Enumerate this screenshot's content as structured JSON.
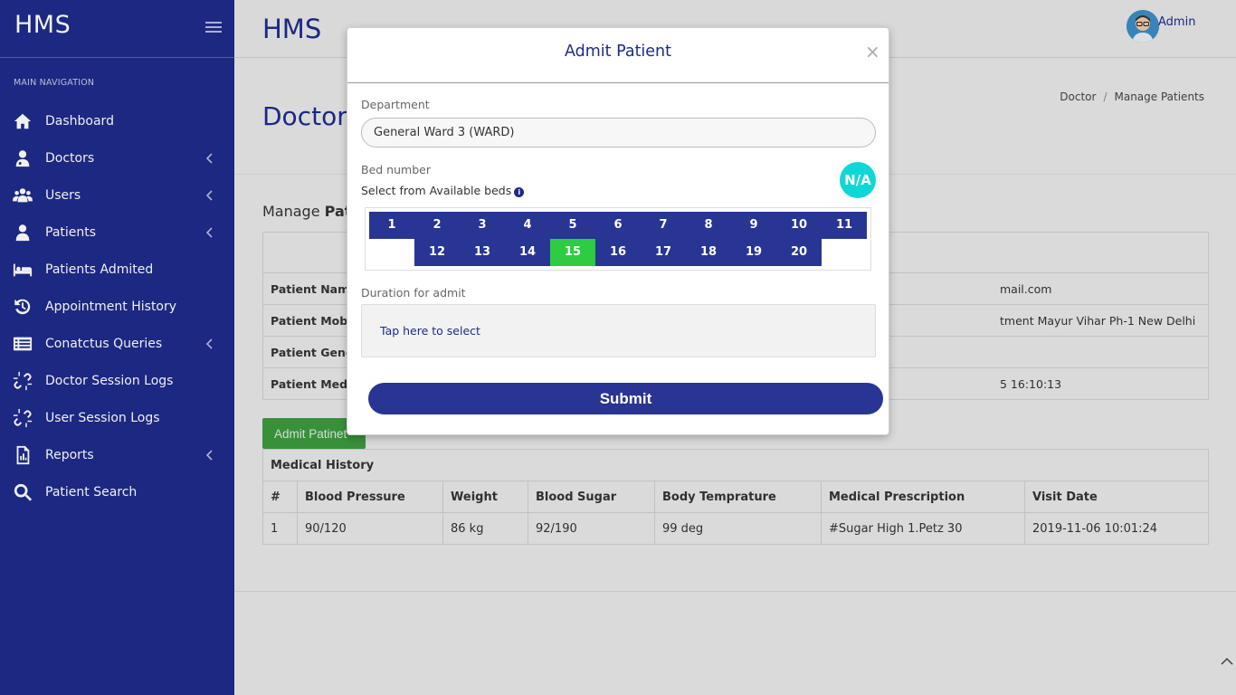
{
  "sidebar": {
    "brand": "HMS",
    "nav_header": "MAIN NAVIGATION",
    "items": [
      {
        "label": "Dashboard",
        "icon": "home-icon",
        "has_submenu": false
      },
      {
        "label": "Doctors",
        "icon": "doctor-icon",
        "has_submenu": true
      },
      {
        "label": "Users",
        "icon": "users-icon",
        "has_submenu": true
      },
      {
        "label": "Patients",
        "icon": "user-icon",
        "has_submenu": true
      },
      {
        "label": "Patients Admited",
        "icon": "bed-icon",
        "has_submenu": false
      },
      {
        "label": "Appointment History",
        "icon": "history-icon",
        "has_submenu": false
      },
      {
        "label": "Conatctus Queries",
        "icon": "list-icon",
        "has_submenu": true
      },
      {
        "label": "Doctor Session Logs",
        "icon": "unlink-icon",
        "has_submenu": false
      },
      {
        "label": "User Session Logs",
        "icon": "unlink-icon",
        "has_submenu": false
      },
      {
        "label": "Reports",
        "icon": "report-icon",
        "has_submenu": true
      },
      {
        "label": "Patient Search",
        "icon": "search-icon",
        "has_submenu": false
      }
    ]
  },
  "topbar": {
    "title": "HMS",
    "user": "Admin"
  },
  "page": {
    "title": "Doctor",
    "breadcrumb": [
      "Doctor",
      "Manage Patients"
    ],
    "heading_prefix": "Manage",
    "heading_bold": "Pati"
  },
  "patient_info": {
    "rows": [
      {
        "key": "Patient Name",
        "value": "mail.com"
      },
      {
        "key": "Patient Mobile",
        "value": "tment Mayur Vihar Ph-1 New Delhi"
      },
      {
        "key": "Patient Gende",
        "value": ""
      },
      {
        "key": "Patient Medic",
        "value": "5 16:10:13"
      }
    ]
  },
  "admit_button": "Admit Patinet",
  "medical_history": {
    "caption": "Medical History",
    "headers": [
      "#",
      "Blood Pressure",
      "Weight",
      "Blood Sugar",
      "Body Temprature",
      "Medical Prescription",
      "Visit Date"
    ],
    "rows": [
      [
        "1",
        "90/120",
        "86 kg",
        "92/190",
        "99 deg",
        "#Sugar High 1.Petz 30",
        "2019-11-06 10:01:24"
      ]
    ]
  },
  "modal": {
    "title": "Admit Patient",
    "close": "×",
    "department_label": "Department",
    "department_value": "General Ward 3 (WARD)",
    "bed_label": "Bed number",
    "bed_sub": "Select from Available beds",
    "badge": "N/A",
    "beds": [
      "1",
      "2",
      "3",
      "4",
      "5",
      "6",
      "7",
      "8",
      "9",
      "10",
      "11",
      "12",
      "13",
      "14",
      "15",
      "16",
      "17",
      "18",
      "19",
      "20"
    ],
    "selected_bed": "15",
    "duration_label": "Duration for admit",
    "duration_placeholder": "Tap here to select",
    "submit": "Submit"
  },
  "colors": {
    "sidebar_bg": "#1e2b8a",
    "primary": "#283593",
    "selected_bed": "#2ecc40",
    "badge": "#10d7d7",
    "admit_button": "#3d9a3f"
  }
}
